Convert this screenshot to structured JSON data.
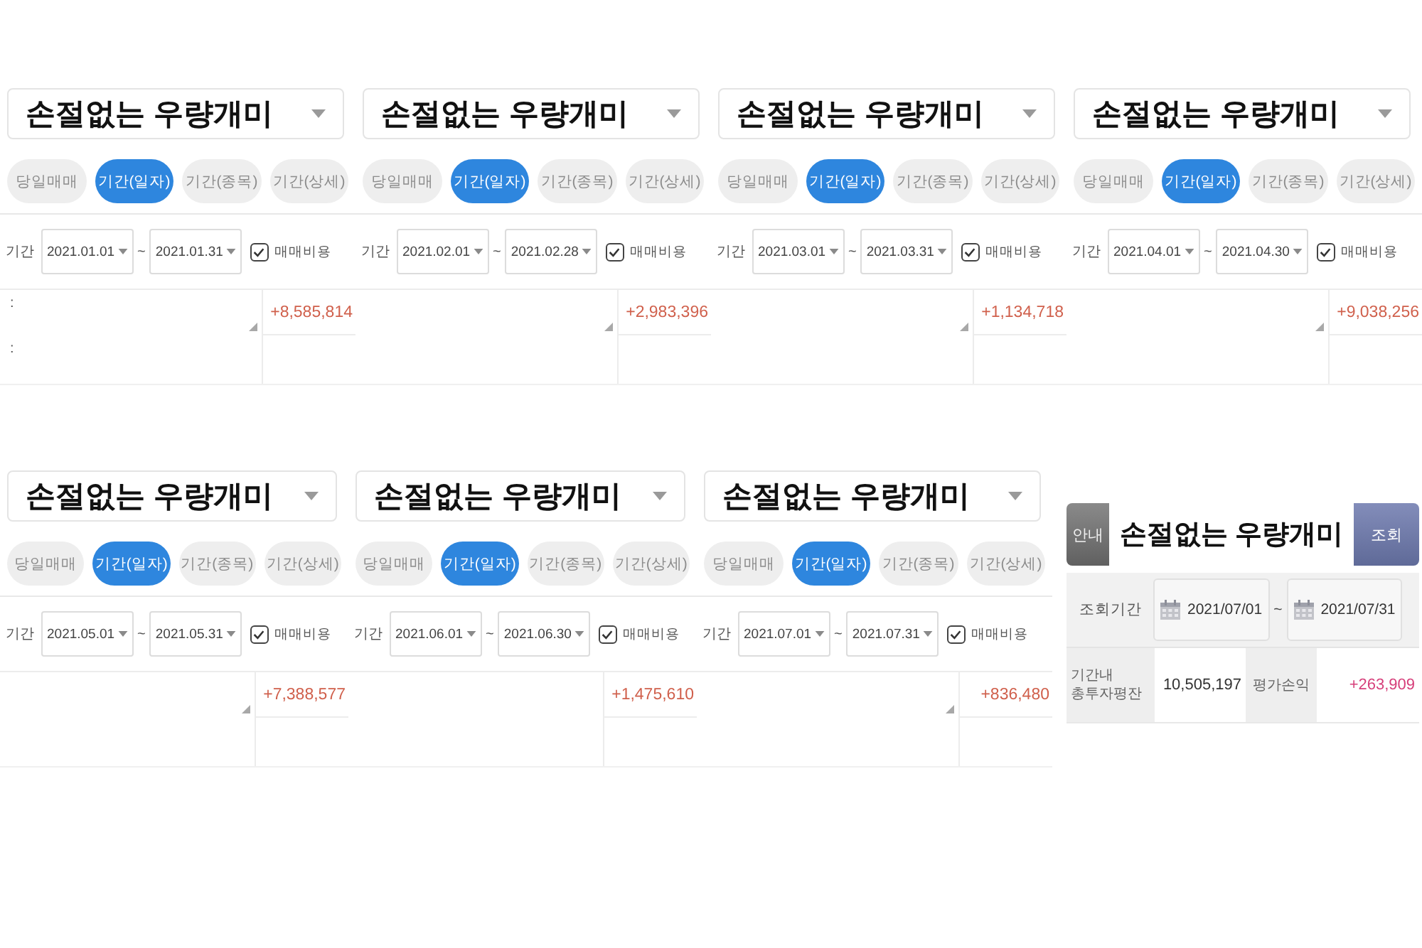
{
  "rows": [
    {
      "panels": [
        {
          "account": "손절없는 우량개미",
          "tabs": [
            {
              "label": "당일매매",
              "selected": false
            },
            {
              "label": "기간(일자)",
              "selected": true
            },
            {
              "label": "기간(종목)",
              "selected": false
            },
            {
              "label": "기간(상세)",
              "selected": false
            }
          ],
          "period": {
            "label": "기간",
            "start": "2021.01.01",
            "separator": "~",
            "end": "2021.01.31"
          },
          "fee_option": {
            "label": "매매비용",
            "checked": true
          },
          "result": {
            "row_marks": [
              ":",
              ":"
            ],
            "resize_grip": true,
            "value": "+8,585,814"
          }
        },
        {
          "account": "손절없는 우량개미",
          "tabs": [
            {
              "label": "당일매매",
              "selected": false
            },
            {
              "label": "기간(일자)",
              "selected": true
            },
            {
              "label": "기간(종목)",
              "selected": false
            },
            {
              "label": "기간(상세)",
              "selected": false
            }
          ],
          "period": {
            "label": "기간",
            "start": "2021.02.01",
            "separator": "~",
            "end": "2021.02.28"
          },
          "fee_option": {
            "label": "매매비용",
            "checked": true
          },
          "result": {
            "resize_grip": true,
            "value": "+2,983,396"
          }
        },
        {
          "account": "손절없는 우량개미",
          "tabs": [
            {
              "label": "당일매매",
              "selected": false
            },
            {
              "label": "기간(일자)",
              "selected": true
            },
            {
              "label": "기간(종목)",
              "selected": false
            },
            {
              "label": "기간(상세)",
              "selected": false
            }
          ],
          "period": {
            "label": "기간",
            "start": "2021.03.01",
            "separator": "~",
            "end": "2021.03.31"
          },
          "fee_option": {
            "label": "매매비용",
            "checked": true
          },
          "result": {
            "resize_grip": true,
            "value": "+1,134,718"
          }
        },
        {
          "account": "손절없는 우량개미",
          "tabs": [
            {
              "label": "당일매매",
              "selected": false
            },
            {
              "label": "기간(일자)",
              "selected": true
            },
            {
              "label": "기간(종목)",
              "selected": false
            },
            {
              "label": "기간(상세)",
              "selected": false
            }
          ],
          "period": {
            "label": "기간",
            "start": "2021.04.01",
            "separator": "~",
            "end": "2021.04.30"
          },
          "fee_option": {
            "label": "매매비용",
            "checked": true
          },
          "result": {
            "resize_grip": true,
            "value": "+9,038,256"
          }
        }
      ]
    },
    {
      "panels": [
        {
          "account": "손절없는 우량개미",
          "tabs": [
            {
              "label": "당일매매",
              "selected": false
            },
            {
              "label": "기간(일자)",
              "selected": true
            },
            {
              "label": "기간(종목)",
              "selected": false
            },
            {
              "label": "기간(상세)",
              "selected": false
            }
          ],
          "period": {
            "label": "기간",
            "start": "2021.05.01",
            "separator": "~",
            "end": "2021.05.31"
          },
          "fee_option": {
            "label": "매매비용",
            "checked": true
          },
          "result": {
            "resize_grip": true,
            "value": "+7,388,577"
          }
        },
        {
          "account": "손절없는 우량개미",
          "tabs": [
            {
              "label": "당일매매",
              "selected": false
            },
            {
              "label": "기간(일자)",
              "selected": true
            },
            {
              "label": "기간(종목)",
              "selected": false
            },
            {
              "label": "기간(상세)",
              "selected": false
            }
          ],
          "period": {
            "label": "기간",
            "start": "2021.06.01",
            "separator": "~",
            "end": "2021.06.30"
          },
          "fee_option": {
            "label": "매매비용",
            "checked": true
          },
          "result": {
            "resize_grip": false,
            "value": "+1,475,610"
          }
        },
        {
          "account": "손절없는 우량개미",
          "tabs": [
            {
              "label": "당일매매",
              "selected": false
            },
            {
              "label": "기간(일자)",
              "selected": true
            },
            {
              "label": "기간(종목)",
              "selected": false
            },
            {
              "label": "기간(상세)",
              "selected": false
            }
          ],
          "period": {
            "label": "기간",
            "start": "2021.07.01",
            "separator": "~",
            "end": "2021.07.31"
          },
          "fee_option": {
            "label": "매매비용",
            "checked": true
          },
          "result": {
            "resize_grip": true,
            "value": "+836,480"
          }
        }
      ],
      "summary_panel": {
        "guide_button": "안내",
        "cover_label": "손절없는 우량개미",
        "search_button": "조회",
        "period": {
          "label": "조회기간",
          "start": "2021/07/01",
          "separator": "~",
          "end": "2021/07/31"
        },
        "stats": [
          {
            "label": "기간내\n총투자평잔",
            "value": "10,505,197"
          },
          {
            "label": "평가손익",
            "value": "+263,909"
          }
        ]
      }
    }
  ]
}
